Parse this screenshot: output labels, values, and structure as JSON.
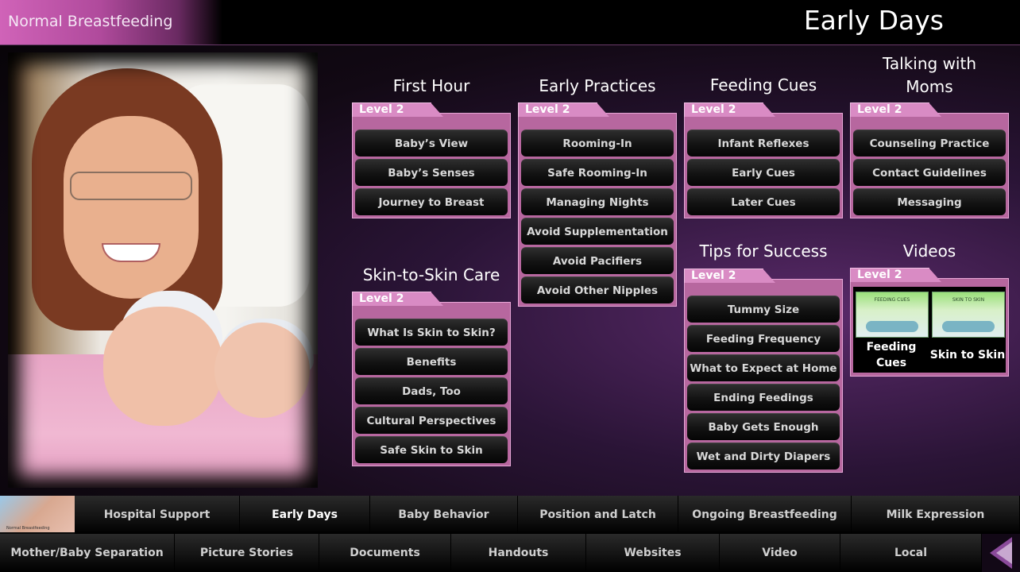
{
  "header": {
    "brand": "Normal Breastfeeding",
    "page_title": "Early Days"
  },
  "level_label": "Level 2",
  "groups": {
    "first_hour": {
      "title": "First Hour",
      "items": [
        "Baby’s View",
        "Baby’s Senses",
        "Journey to Breast"
      ]
    },
    "early_practices": {
      "title": "Early Practices",
      "items": [
        "Rooming-In",
        "Safe Rooming-In",
        "Managing Nights",
        "Avoid Supplementation",
        "Avoid Pacifiers",
        "Avoid Other Nipples"
      ]
    },
    "feeding_cues": {
      "title": "Feeding Cues",
      "items": [
        "Infant Reflexes",
        "Early Cues",
        "Later Cues"
      ]
    },
    "talking_with_moms": {
      "title_line1": "Talking with",
      "title_line2": "Moms",
      "items": [
        "Counseling Practice",
        "Contact Guidelines",
        "Messaging"
      ]
    },
    "skin_to_skin": {
      "title": "Skin-to-Skin Care",
      "items": [
        "What Is Skin to Skin?",
        "Benefits",
        "Dads, Too",
        "Cultural Perspectives",
        "Safe Skin to Skin"
      ]
    },
    "tips_for_success": {
      "title": "Tips for Success",
      "items": [
        "Tummy Size",
        "Feeding Frequency",
        "What to Expect at Home",
        "Ending Feedings",
        "Baby Gets Enough",
        "Wet and Dirty Diapers"
      ]
    },
    "videos": {
      "title": "Videos",
      "items": [
        {
          "label_line1": "Feeding",
          "label_line2": "Cues",
          "thumb_text": "FEEDING CUES"
        },
        {
          "label": "Skin to Skin",
          "thumb_text": "SKIN TO SKIN"
        }
      ]
    }
  },
  "nav_row1": [
    "Hospital Support",
    "Early Days",
    "Baby Behavior",
    "Position and Latch",
    "Ongoing Breastfeeding",
    "Milk Expression"
  ],
  "nav_row2": [
    "Mother/Baby Separation",
    "Picture Stories",
    "Documents",
    "Handouts",
    "Websites",
    "Video",
    "Local"
  ],
  "nav_thumb_caption": "Normal Breastfeeding",
  "colors": {
    "panel_pink": "#b7679f",
    "level_tab": "#d98bc4",
    "brand_gradient": "#d063b8"
  }
}
